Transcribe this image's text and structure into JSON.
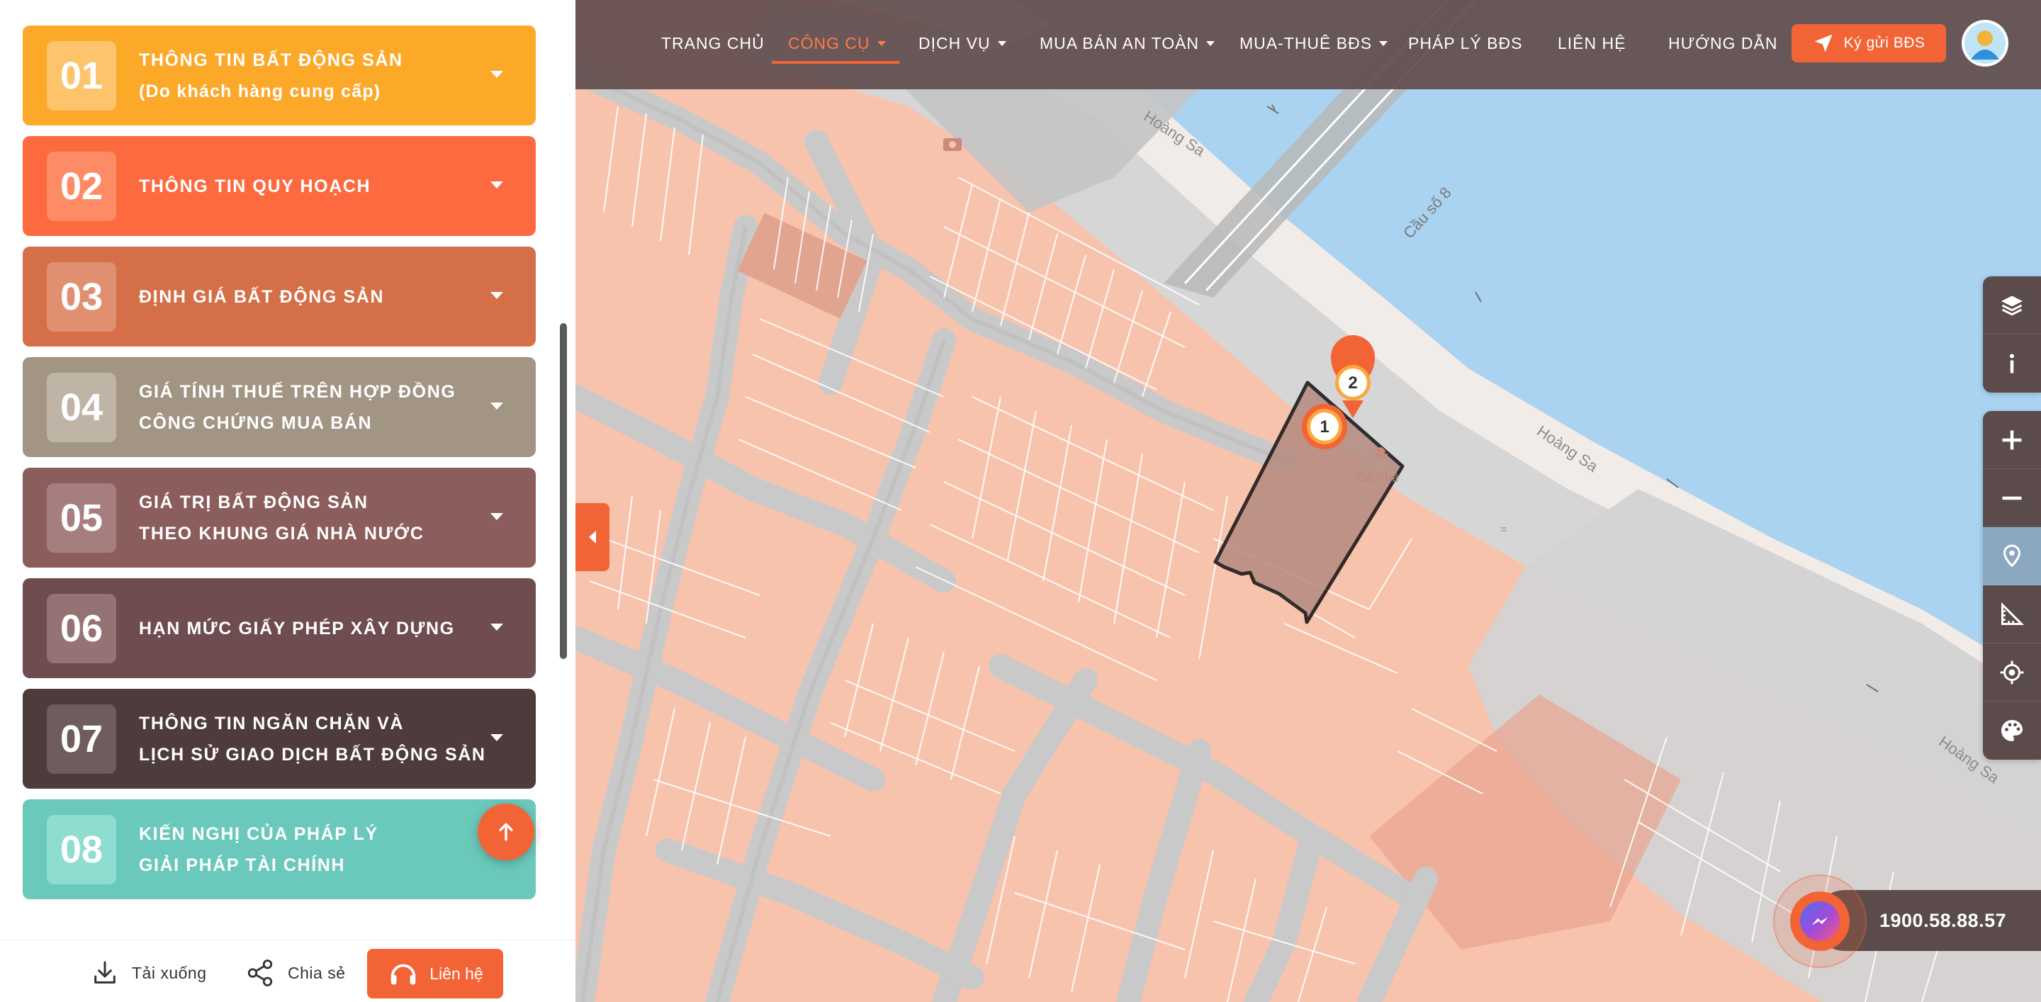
{
  "sidebar": {
    "cards": [
      {
        "num": "01",
        "line1": "THÔNG TIN BẤT ĐỘNG SẢN",
        "line2": "(Do khách hàng cung cấp)",
        "color": "#fca92a",
        "badge": "#fdc46b"
      },
      {
        "num": "02",
        "line1": "THÔNG TIN QUY HOẠCH",
        "line2": "",
        "color": "#fd6a3f",
        "badge": "#fd8c66"
      },
      {
        "num": "03",
        "line1": "ĐỊNH GIÁ BẤT ĐỘNG SẢN",
        "line2": "",
        "color": "#d56f47",
        "badge": "#e09070"
      },
      {
        "num": "04",
        "line1": "GIÁ TÍNH THUẾ TRÊN HỢP ĐỒNG",
        "line2": "CÔNG CHỨNG MUA BÁN",
        "color": "#a39584",
        "badge": "#bfb4a6"
      },
      {
        "num": "05",
        "line1": "GIÁ TRỊ BẤT ĐỘNG SẢN",
        "line2": "THEO KHUNG GIÁ NHÀ NƯỚC",
        "color": "#8c5d5d",
        "badge": "#a67e7e"
      },
      {
        "num": "06",
        "line1": "HẠN MỨC GIẤY PHÉP XÂY DỰNG",
        "line2": "",
        "color": "#6e4c4f",
        "badge": "#957274"
      },
      {
        "num": "07",
        "line1": "THÔNG TIN NGĂN CHẶN VÀ",
        "line2": "LỊCH SỬ GIAO DỊCH BẤT ĐỘNG SẢN",
        "color": "#4e3b3c",
        "badge": "#6f5d5e"
      },
      {
        "num": "08",
        "line1": "KIẾN NGHỊ CỦA PHÁP LÝ",
        "line2": "GIẢI PHÁP TÀI CHÍNH",
        "color": "#6bc9bb",
        "badge": "#8fdcd1"
      }
    ]
  },
  "bottom_bar": {
    "download": "Tải xuống",
    "share": "Chia sẻ",
    "contact": "Liên hệ"
  },
  "nav": {
    "home": "TRANG CHỦ",
    "tools": "CÔNG CỤ",
    "services": "DỊCH VỤ",
    "safe_trade": "MUA BÁN AN TOÀN",
    "buy_rent": "MUA-THUÊ BĐS",
    "legal": "PHÁP LÝ BĐS",
    "contact": "LIÊN HỆ",
    "guide": "HƯỚNG DẪN",
    "send_btn": "Ký gửi BĐS"
  },
  "map": {
    "street_labels": [
      "Hoàng Sa",
      "Hoàng Sa",
      "Hoàng Sa"
    ],
    "bridge_label": "Cầu số 8",
    "poi_label": "Cà Phê",
    "markers": [
      "1",
      "2"
    ]
  },
  "hotline": "1900.58.88.57",
  "colors": {
    "accent": "#f26436",
    "nav_bg": "#624e4e",
    "land": "#f8c3ad",
    "water": "#a9d3f0",
    "road": "#d3d3d3"
  }
}
